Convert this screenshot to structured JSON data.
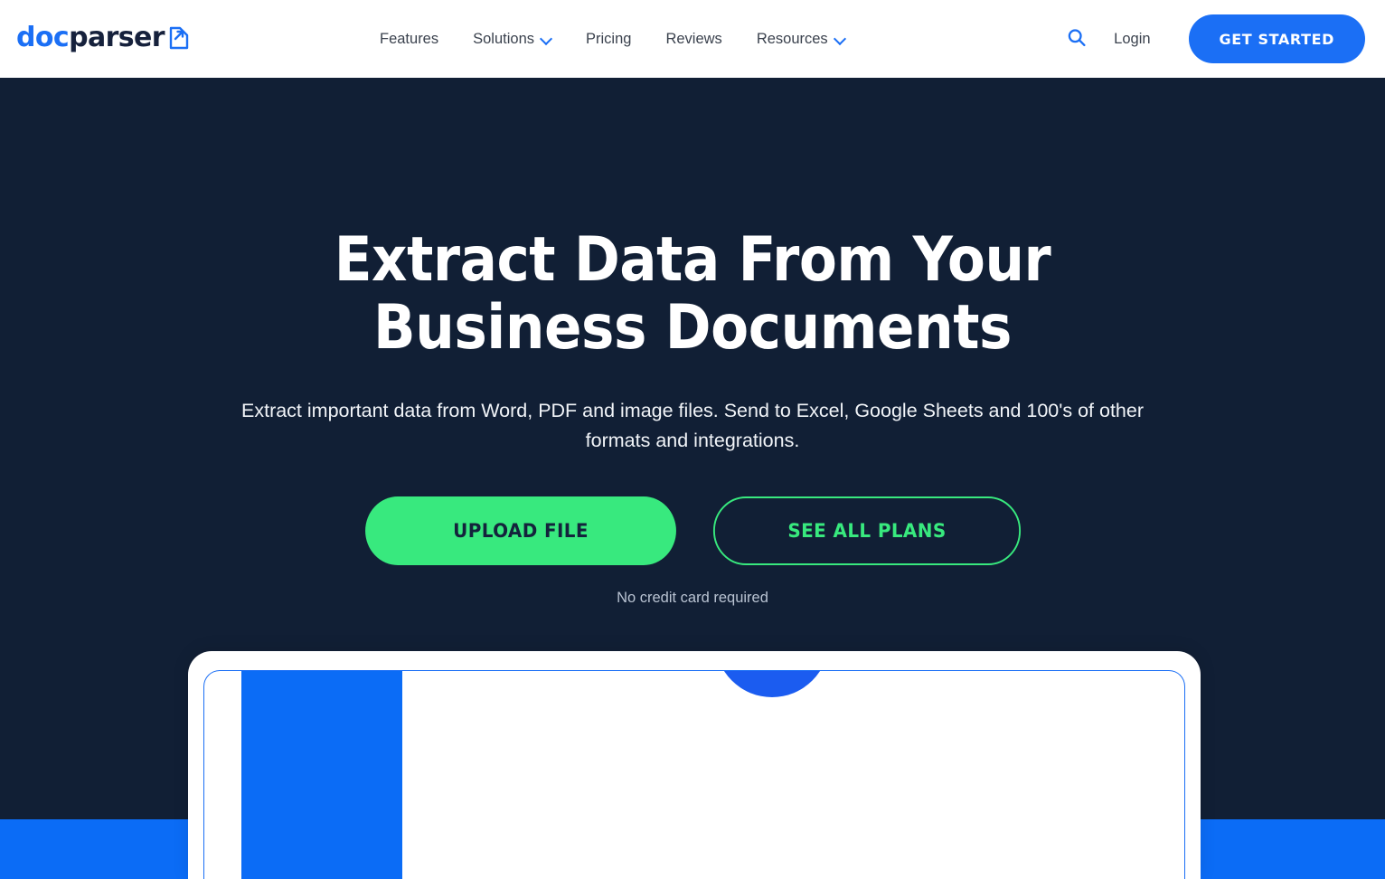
{
  "header": {
    "logo": {
      "text_primary": "doc",
      "text_secondary": "parser",
      "mark_icon": "document-export-icon"
    },
    "nav": [
      {
        "label": "Features",
        "has_dropdown": false,
        "icon": ""
      },
      {
        "label": "Solutions",
        "has_dropdown": true,
        "icon": "chevron-down-icon"
      },
      {
        "label": "Pricing",
        "has_dropdown": false,
        "icon": ""
      },
      {
        "label": "Reviews",
        "has_dropdown": false,
        "icon": ""
      },
      {
        "label": "Resources",
        "has_dropdown": true,
        "icon": "chevron-down-icon"
      }
    ],
    "search_icon": "search-icon",
    "login_label": "Login",
    "cta_label": "GET STARTED"
  },
  "hero": {
    "title_line1": "Extract Data From Your",
    "title_line2": "Business Documents",
    "subtitle": "Extract important data from Word, PDF and image files. Send to Excel, Google Sheets and 100's of other formats and integrations.",
    "primary_cta": "UPLOAD FILE",
    "secondary_cta": "SEE ALL PLANS",
    "note": "No credit card required"
  },
  "app_preview": {
    "sidebar_label": "app-sidebar-panel",
    "avatar_label": "avatar-blob",
    "frame_label": "app-window-frame"
  },
  "colors": {
    "navy": "#111f35",
    "blue": "#1b6ff5",
    "blue_band": "#0b6cf6",
    "green": "#38e97e",
    "white": "#ffffff",
    "nav_text": "#3b424e",
    "note_text": "#b9c3d2"
  }
}
